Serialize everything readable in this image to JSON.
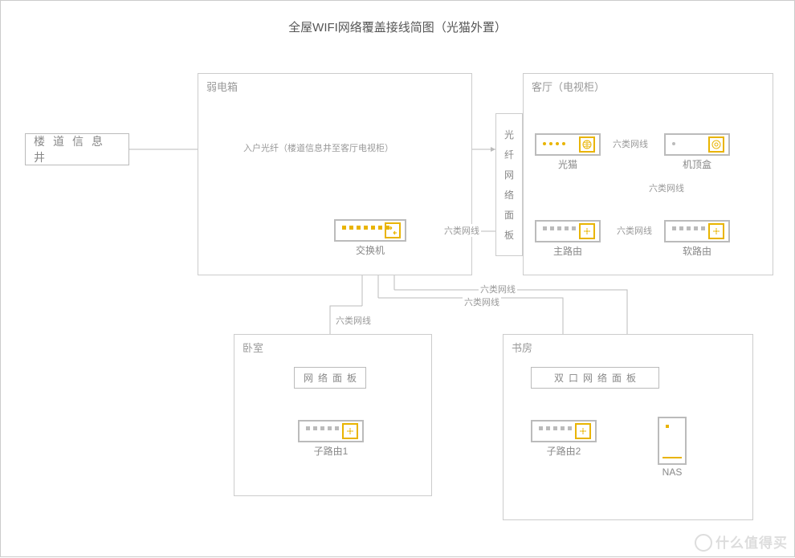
{
  "title": "全屋WIFI网络覆盖接线简图（光猫外置）",
  "info_well": "楼道信息井",
  "zones": {
    "weakbox": "弱电箱",
    "living": "客厅（电视柜）",
    "bedroom": "卧室",
    "study": "书房"
  },
  "panels": {
    "fiber_panel": "光纤网络面板",
    "net_panel": "网络面板",
    "dual_panel": "双口网络面板"
  },
  "devices": {
    "switch": "交换机",
    "modem": "光猫",
    "stb": "机顶盒",
    "main_router": "主路由",
    "soft_router": "软路由",
    "child_router1": "子路由1",
    "child_router2": "子路由2",
    "nas": "NAS"
  },
  "cables": {
    "fiber_in": "入户光纤（楼道信息井至客厅电视柜）",
    "cat6": "六类网线"
  },
  "watermark": "什么值得买"
}
